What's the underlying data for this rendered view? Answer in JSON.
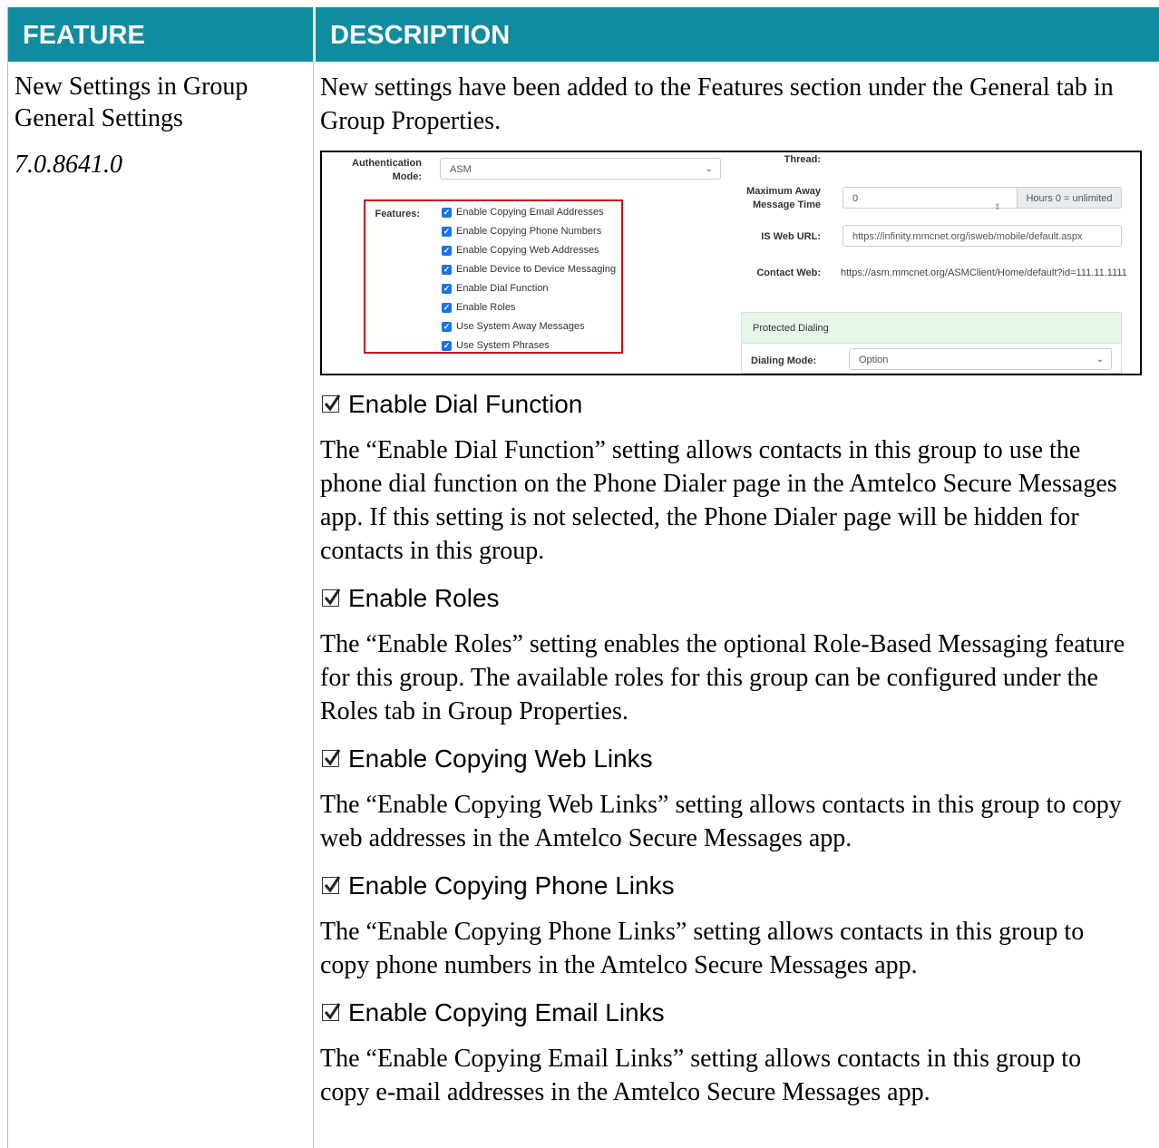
{
  "header": {
    "feature": "FEATURE",
    "description": "DESCRIPTION"
  },
  "feature": {
    "title": "New Settings in Group General Settings",
    "version": "7.0.8641.0"
  },
  "intro": "New settings have been added to the Features section under the General tab in Group Properties.",
  "screenshot": {
    "auth_label": "Authentication Mode:",
    "auth_value": "ASM",
    "features_label": "Features:",
    "features": [
      "Enable Copying Email Addresses",
      "Enable Copying Phone Numbers",
      "Enable Copying Web Addresses",
      "Enable Device to Device Messaging",
      "Enable Dial Function",
      "Enable Roles",
      "Use System Away Messages",
      "Use System Phrases"
    ],
    "thread_label": "Thread:",
    "max_away_label": "Maximum Away Message Time",
    "max_away_value": "0",
    "hours_hint": "Hours 0 = unlimited",
    "isweb_label": "IS Web URL:",
    "isweb_value": "https://infinity.mmcnet.org/isweb/mobile/default.aspx",
    "contactweb_label": "Contact Web:",
    "contactweb_value": "https://asm.mmcnet.org/ASMClient/Home/default?id=111.11.1111",
    "protected_dialing": "Protected Dialing",
    "dialing_mode_label": "Dialing Mode:",
    "dialing_mode_value": "Option"
  },
  "sections": [
    {
      "title": "Enable Dial Function",
      "body": "The “Enable Dial Function” setting allows contacts in this group to use the phone dial function on the Phone Dialer page in the Amtelco Secure Messages app. If this setting is not selected, the Phone Dialer page will be hidden for contacts in this group."
    },
    {
      "title": "Enable Roles",
      "body": "The “Enable Roles” setting enables the optional Role-Based Messaging feature for this group. The available roles for this group can be configured under the Roles tab in Group Properties."
    },
    {
      "title": "Enable Copying Web Links",
      "body": "The “Enable Copying Web Links” setting allows contacts in this group to copy web addresses in the Amtelco Secure Messages app."
    },
    {
      "title": "Enable Copying Phone Links",
      "body": "The “Enable Copying Phone Links” setting allows contacts in this group to copy phone numbers in the Amtelco Secure Messages app."
    },
    {
      "title": "Enable Copying Email Links",
      "body": "The “Enable Copying Email Links” setting allows contacts in this group to copy e-mail addresses in the Amtelco Secure Messages app."
    }
  ]
}
